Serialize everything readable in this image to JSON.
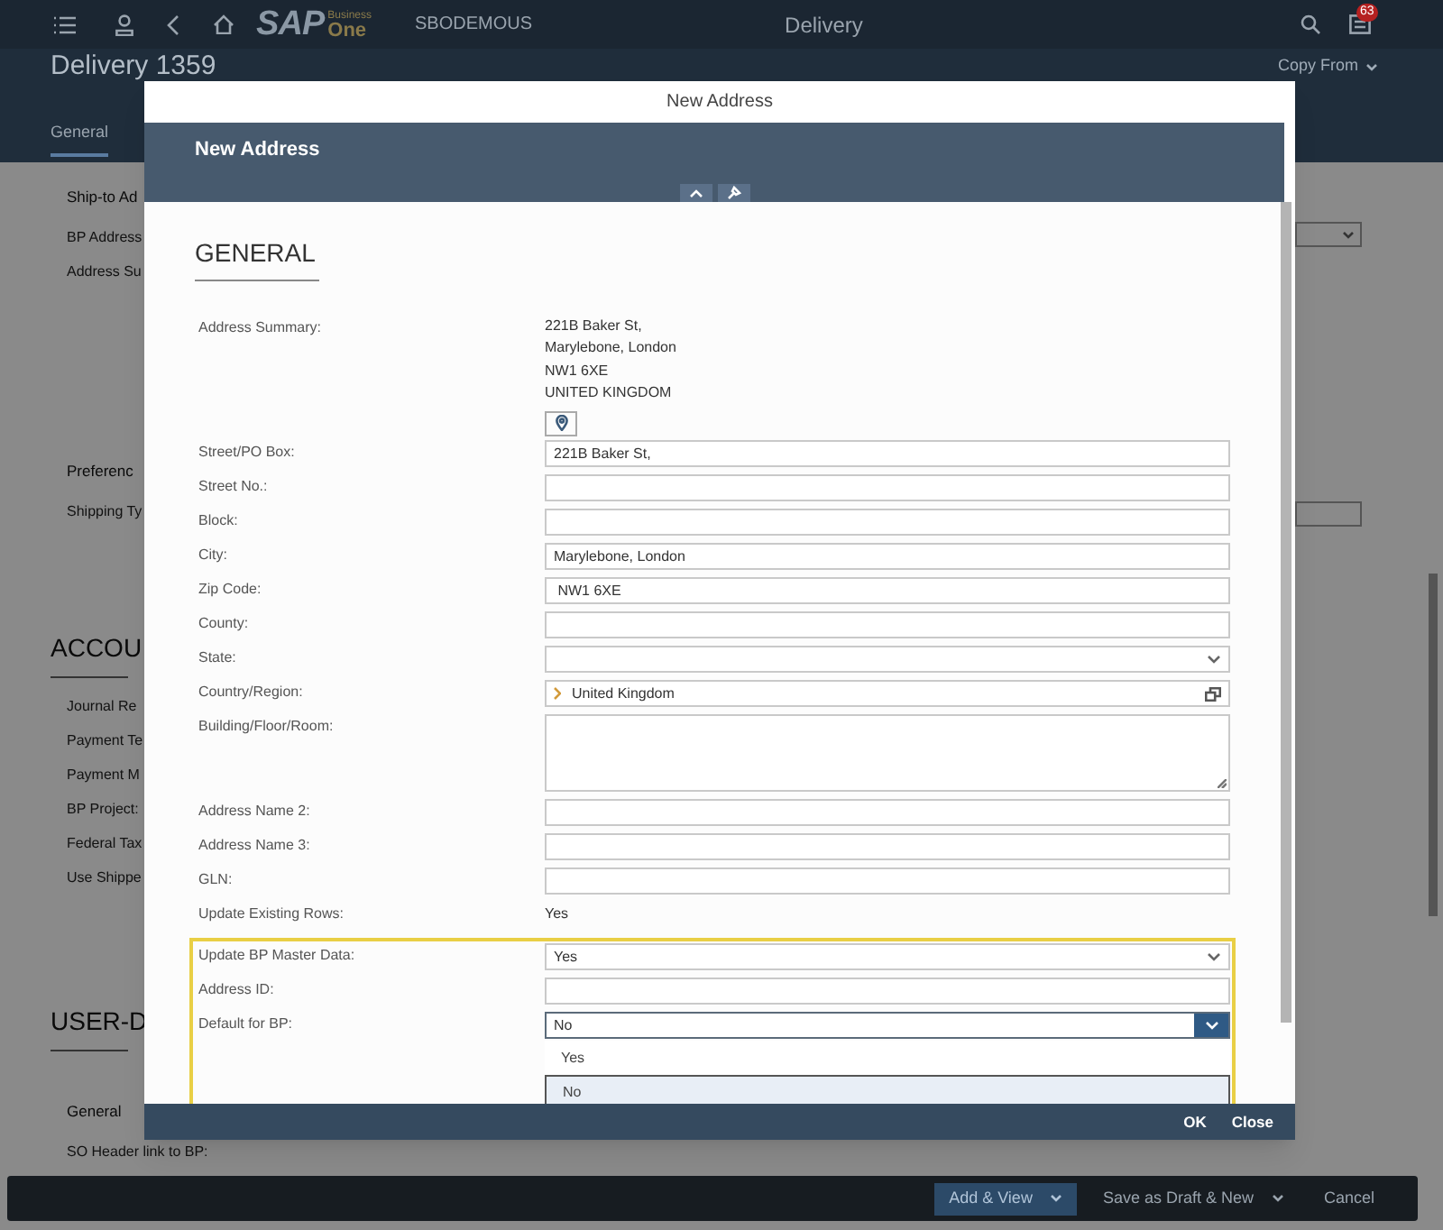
{
  "shell": {
    "logo": {
      "main": "SAP",
      "sup": "Business",
      "sub": "One"
    },
    "company": "SBODEMOUS",
    "title": "Delivery",
    "notification_count": "63"
  },
  "page": {
    "title": "Delivery 1359",
    "copy_from": "Copy From",
    "tabs": [
      {
        "label": "General",
        "selected": true
      }
    ],
    "sections": [
      {
        "kind": "subsection",
        "title": "Ship-to Ad",
        "fields": [
          "BP Address",
          "Address Su"
        ]
      },
      {
        "kind": "subsection",
        "title": "Preferenc",
        "fields": [
          "Shipping Ty"
        ]
      },
      {
        "kind": "section",
        "title": "ACCOU",
        "fields": [
          "Journal Re",
          "Payment Te",
          "Payment M",
          "BP Project:",
          "Federal Tax",
          "Use Shippe"
        ]
      },
      {
        "kind": "section",
        "title": "USER-D"
      },
      {
        "kind": "subsection",
        "title": "General",
        "fields": [
          "SO Header link to BP:"
        ]
      }
    ]
  },
  "dialog": {
    "window_title": "New Address",
    "header_title": "New Address",
    "section_title": "GENERAL",
    "fields": [
      {
        "kind": "summary",
        "label": "Address Summary:",
        "lines": [
          "221B Baker St,",
          "Marylebone, London",
          "NW1 6XE",
          "UNITED KINGDOM"
        ]
      },
      {
        "kind": "map_button"
      },
      {
        "kind": "input",
        "label": "Street/PO Box:",
        "value": "221B Baker St,"
      },
      {
        "kind": "input",
        "label": "Street No.:"
      },
      {
        "kind": "input",
        "label": "Block:"
      },
      {
        "kind": "input",
        "label": "City:",
        "value": "Marylebone, London"
      },
      {
        "kind": "input",
        "label": "Zip Code:",
        "value": " NW1 6XE"
      },
      {
        "kind": "input",
        "label": "County:"
      },
      {
        "kind": "select",
        "label": "State:"
      },
      {
        "kind": "value_help",
        "label": "Country/Region:",
        "value": "United Kingdom"
      },
      {
        "kind": "textarea",
        "label": "Building/Floor/Room:"
      },
      {
        "kind": "input",
        "label": "Address Name 2:"
      },
      {
        "kind": "input",
        "label": "Address Name 3:"
      },
      {
        "kind": "input",
        "label": "GLN:"
      },
      {
        "kind": "static",
        "label": "Update Existing Rows:",
        "value": "Yes"
      }
    ],
    "highlighted_fields": [
      {
        "kind": "select",
        "label": "Update BP Master Data:",
        "value": "Yes"
      },
      {
        "kind": "input",
        "label": "Address ID:"
      },
      {
        "kind": "dropdown",
        "label": "Default for BP:",
        "value": "No",
        "options": [
          {
            "label": "Yes",
            "selected": false
          },
          {
            "label": "No",
            "selected": true
          }
        ]
      }
    ],
    "buttons": [
      "OK",
      "Close"
    ]
  },
  "footer": {
    "buttons": [
      {
        "label": "Add & View",
        "primary": true,
        "caret": true
      },
      {
        "label": "Save as Draft & New",
        "primary": false,
        "caret": true
      },
      {
        "label": "Cancel",
        "primary": false,
        "caret": false
      }
    ]
  }
}
